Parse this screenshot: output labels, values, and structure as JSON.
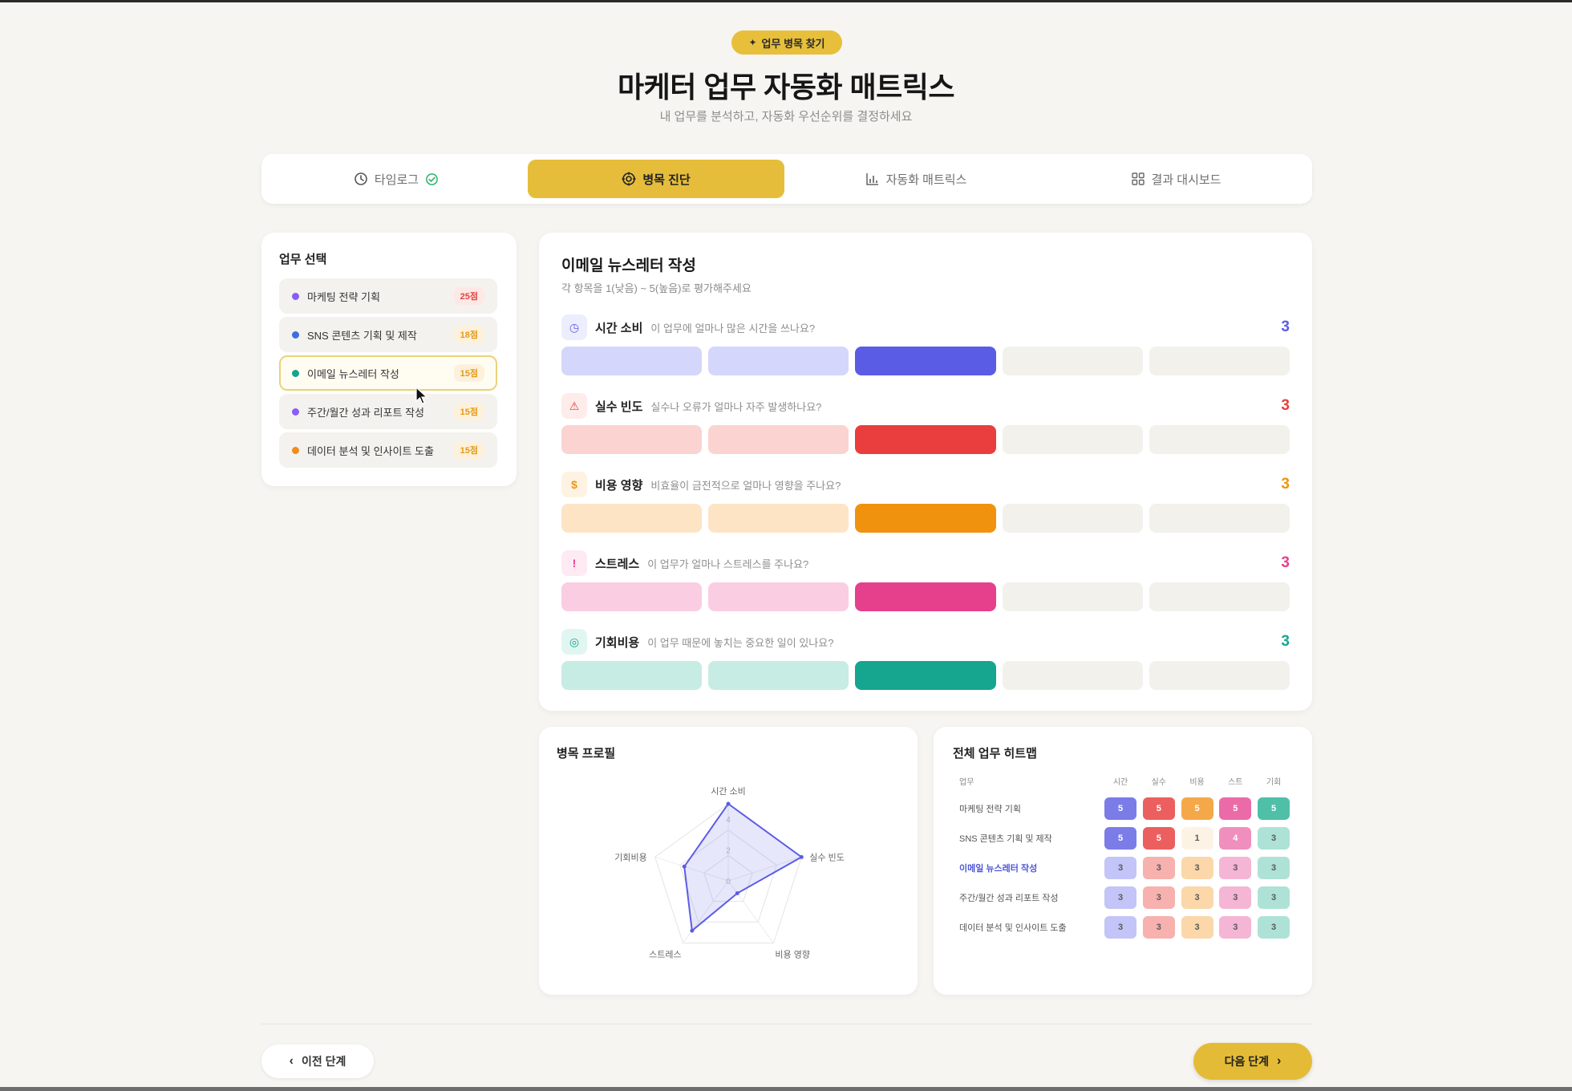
{
  "header": {
    "badge_label": "업무 병목 찾기",
    "title": "마케터 업무 자동화 매트릭스",
    "subtitle": "내 업무를 분석하고, 자동화 우선순위를 결정하세요"
  },
  "tabs": [
    {
      "label": "타임로그",
      "icon": "clock-icon",
      "done": true
    },
    {
      "label": "병목 진단",
      "icon": "target-icon",
      "active": true
    },
    {
      "label": "자동화 매트릭스",
      "icon": "bar-chart-icon"
    },
    {
      "label": "결과 대시보드",
      "icon": "grid-icon"
    }
  ],
  "task_panel": {
    "label": "업무 선택",
    "tasks": [
      {
        "name": "마케팅 전략 기획",
        "score": "25점",
        "dot": "#8b5cf6",
        "score_color": "#e0453f",
        "score_bg": "#fde8e6"
      },
      {
        "name": "SNS 콘텐츠 기획 및 제작",
        "score": "18점",
        "dot": "#3b6fe0",
        "score_color": "#e39a17",
        "score_bg": "#fdf1dc"
      },
      {
        "name": "이메일 뉴스레터 작성",
        "score": "15점",
        "dot": "#16a58a",
        "score_color": "#e39a17",
        "score_bg": "#fdf1dc",
        "selected": true
      },
      {
        "name": "주간/월간 성과 리포트 작성",
        "score": "15점",
        "dot": "#8b5cf6",
        "score_color": "#e39a17",
        "score_bg": "#fdf1dc"
      },
      {
        "name": "데이터 분석 및 인사이트 도출",
        "score": "15점",
        "dot": "#f08c1e",
        "score_color": "#e39a17",
        "score_bg": "#fdf1dc"
      }
    ]
  },
  "rating": {
    "title": "이메일 뉴스레터 작성",
    "subtitle": "각 항목을 1(낮음) ~ 5(높음)로 평가해주세요",
    "criteria": [
      {
        "name": "시간 소비",
        "question": "이 업무에 얼마나 많은 시간을 쓰나요?",
        "value": 3,
        "icon": "clock-icon",
        "glyph": "◷",
        "strong": "#5b5ce6",
        "light": "#d5d6fb",
        "icon_bg": "#ecedfd",
        "icon_color": "#5b5ce6"
      },
      {
        "name": "실수 빈도",
        "question": "실수나 오류가 얼마나 자주 발생하나요?",
        "value": 3,
        "icon": "warning-icon",
        "glyph": "⚠",
        "strong": "#ea3d3d",
        "light": "#fbd3d1",
        "icon_bg": "#fdecea",
        "icon_color": "#e04040"
      },
      {
        "name": "비용 영향",
        "question": "비효율이 금전적으로 얼마나 영향을 주나요?",
        "value": 3,
        "icon": "dollar-icon",
        "glyph": "$",
        "strong": "#f1920e",
        "light": "#fde4c4",
        "icon_bg": "#fef3e2",
        "icon_color": "#f0961a"
      },
      {
        "name": "스트레스",
        "question": "이 업무가 얼마나 스트레스를 주나요?",
        "value": 3,
        "icon": "alert-circle-icon",
        "glyph": "!",
        "strong": "#e63f8c",
        "light": "#fbcde2",
        "icon_bg": "#fdeaf3",
        "icon_color": "#e63f8c"
      },
      {
        "name": "기회비용",
        "question": "이 업무 때문에 놓치는 중요한 일이 있나요?",
        "value": 3,
        "icon": "target-icon",
        "glyph": "◎",
        "strong": "#16a58e",
        "light": "#c7ece3",
        "icon_bg": "#e2f6f1",
        "icon_color": "#16a58e"
      }
    ],
    "empty_color": "#f2f1ec"
  },
  "radar": {
    "title": "병목 프로필",
    "chart_data": {
      "type": "radar",
      "axes": [
        "시간 소비",
        "실수 빈도",
        "비용 영향",
        "스트레스",
        "기회비용"
      ],
      "values": [
        5,
        5,
        1,
        4,
        3
      ],
      "ticks": [
        "0",
        "2",
        "4"
      ],
      "range": [
        0,
        5
      ],
      "color": "#5b5ce6"
    }
  },
  "heatmap": {
    "title": "전체 업무 히트맵",
    "header_name": "업무",
    "columns": [
      "시간",
      "실수",
      "비용",
      "스트",
      "기회"
    ],
    "rows": [
      {
        "name": "마케팅 전략 기획",
        "values": [
          5,
          5,
          5,
          5,
          5
        ]
      },
      {
        "name": "SNS 콘텐츠 기획 및 제작",
        "values": [
          5,
          5,
          1,
          4,
          3
        ]
      },
      {
        "name": "이메일 뉴스레터 작성",
        "values": [
          3,
          3,
          3,
          3,
          3
        ],
        "selected": true
      },
      {
        "name": "주간/월간 성과 리포트 작성",
        "values": [
          3,
          3,
          3,
          3,
          3
        ]
      },
      {
        "name": "데이터 분석 및 인사이트 도출",
        "values": [
          3,
          3,
          3,
          3,
          3
        ]
      }
    ],
    "colors": {
      "5": [
        "#7b7ce8",
        "#ec5f5f",
        "#f5a84a",
        "#ea6ba8",
        "#4fbfa8"
      ],
      "4": [
        "#9fa0ef",
        "#f28a87",
        "#f8c07a",
        "#f08fbe",
        "#7fd0bf"
      ],
      "3": [
        "#c3c4f7",
        "#f7b1ae",
        "#fbd7a9",
        "#f5b5d4",
        "#aee2d6"
      ],
      "1": [
        "#eeeefd",
        "#fdecea",
        "#fdf3e5",
        "#fdeef5",
        "#e8f7f3"
      ]
    }
  },
  "footer": {
    "prev_label": "이전 단계",
    "next_label": "다음 단계"
  }
}
